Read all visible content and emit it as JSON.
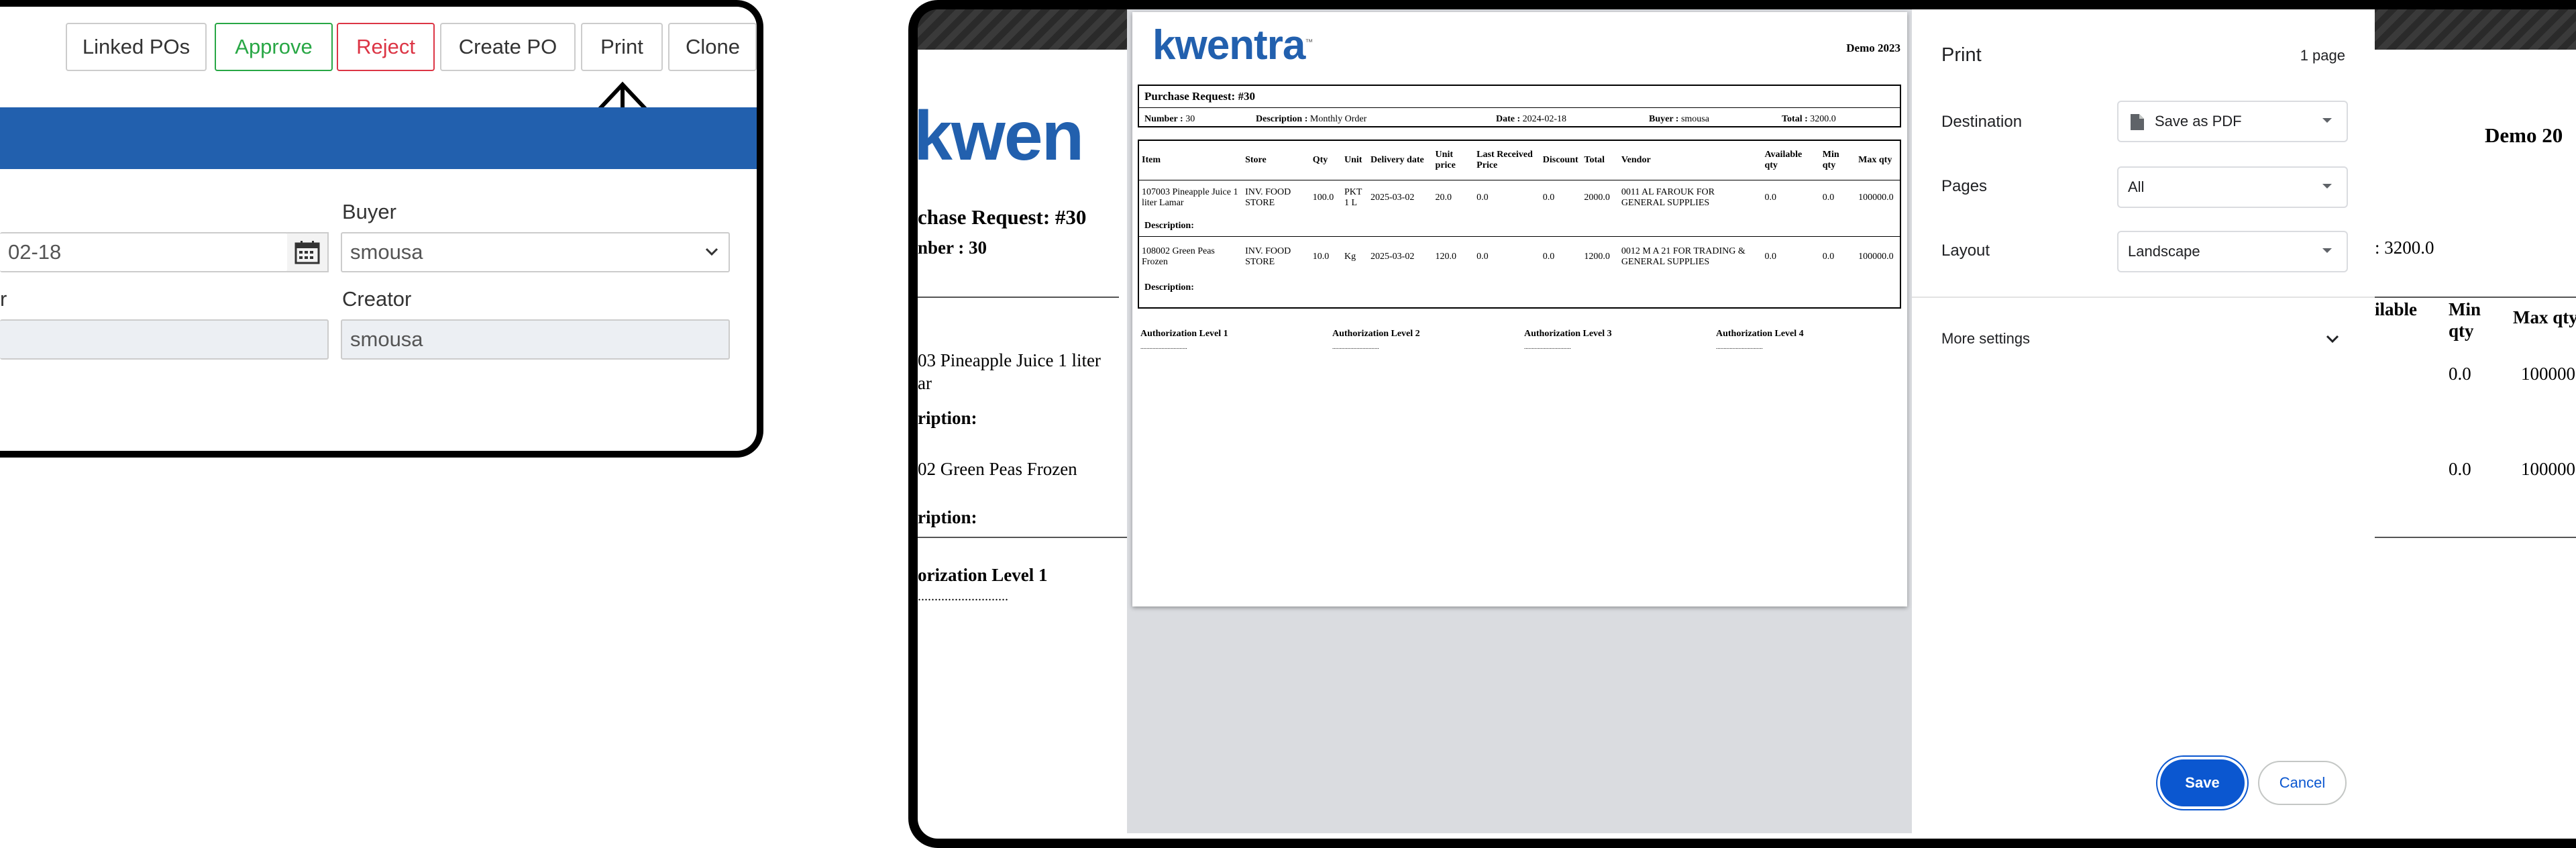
{
  "toolbar": {
    "linked_pos": "Linked POs",
    "approve": "Approve",
    "reject": "Reject",
    "create_po": "Create PO",
    "print": "Print",
    "clone": "Clone"
  },
  "form": {
    "date_value": "02-18",
    "buyer_label": "Buyer",
    "buyer_value": "smousa",
    "left_label": "r",
    "creator_label": "Creator",
    "creator_value": "smousa"
  },
  "background_doc": {
    "logo": "kwen",
    "title": "chase Request: #30",
    "number_line": "nber : 30",
    "demo": "Demo 20",
    "total": ": 3200.0",
    "item1": "03 Pineapple Juice 1 liter",
    "item1b": "ar",
    "desc1": "ription:",
    "item2": "02 Green Peas Frozen",
    "desc2": "ription:",
    "auth": "orization Level 1",
    "dots": "...........................",
    "col_available": "ilable",
    "col_min": "Min",
    "col_min2": "qty",
    "col_max": "Max qty",
    "r1_min": "0.0",
    "r1_max": "100000",
    "r2_min": "0.0",
    "r2_max": "100000"
  },
  "print_preview": {
    "logo": "kwentra",
    "logo_tm": "™",
    "company": "Demo 2023",
    "pr_title": "Purchase Request: #30",
    "number_label": "Number :",
    "number_value": "30",
    "desc_label": "Description :",
    "desc_value": "Monthly Order",
    "date_label": "Date :",
    "date_value": "2024-02-18",
    "buyer_label": "Buyer :",
    "buyer_value": "smousa",
    "total_label": "Total :",
    "total_value": "3200.0",
    "columns": [
      "Item",
      "Store",
      "Qty",
      "Unit",
      "Delivery date",
      "Unit price",
      "Last Received Price",
      "Discount",
      "Total",
      "Vendor",
      "Available qty",
      "Min qty",
      "Max qty"
    ],
    "rows": [
      {
        "item": "107003 Pineapple Juice 1 liter Lamar",
        "store": "INV. FOOD STORE",
        "qty": "100.0",
        "unit": "PKT 1 L",
        "delivery": "2025-03-02",
        "price": "20.0",
        "last": "0.0",
        "discount": "0.0",
        "total": "2000.0",
        "vendor": "0011 AL FAROUK FOR GENERAL SUPPLIES",
        "available": "0.0",
        "min": "0.0",
        "max": "100000.0",
        "desc": "Description:"
      },
      {
        "item": "108002 Green Peas Frozen",
        "store": "INV. FOOD STORE",
        "qty": "10.0",
        "unit": "Kg",
        "delivery": "2025-03-02",
        "price": "120.0",
        "last": "0.0",
        "discount": "0.0",
        "total": "1200.0",
        "vendor": "0012 M A 21 FOR TRADING & GENERAL SUPPLIES",
        "available": "0.0",
        "min": "0.0",
        "max": "100000.0",
        "desc": "Description:"
      }
    ],
    "auth_levels": [
      "Authorization Level 1",
      "Authorization Level 2",
      "Authorization Level 3",
      "Authorization Level 4"
    ],
    "auth_dots": "..............................."
  },
  "print_dialog": {
    "title": "Print",
    "page_count": "1 page",
    "destination_label": "Destination",
    "destination_value": "Save as PDF",
    "pages_label": "Pages",
    "pages_value": "All",
    "layout_label": "Layout",
    "layout_value": "Landscape",
    "more_settings": "More settings",
    "save": "Save",
    "cancel": "Cancel"
  },
  "colors": {
    "brand_blue": "#2260ae",
    "save_blue": "#0b57d0",
    "approve_green": "#28a745",
    "reject_red": "#dc3545"
  }
}
